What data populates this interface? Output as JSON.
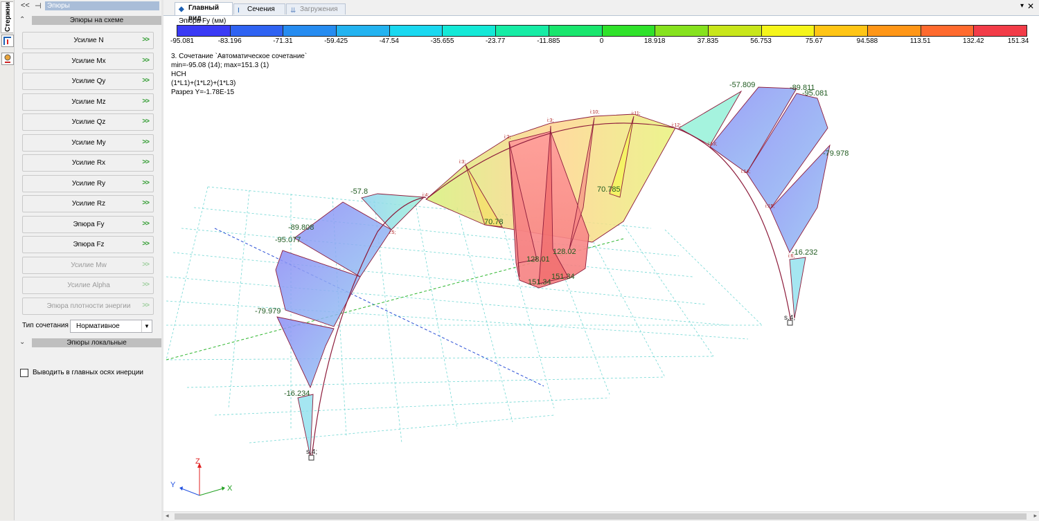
{
  "side_tab": {
    "label": "Стержни"
  },
  "left_panel": {
    "header_back": "<<",
    "header_pin": "⊣",
    "title": "Эпюры",
    "section1": {
      "chevron": "⌃",
      "title": "Эпюры на схеме"
    },
    "buttons": [
      {
        "label": "Усилие N",
        "arrow": ">>",
        "enabled": true
      },
      {
        "label": "Усилие Mx",
        "arrow": ">>",
        "enabled": true
      },
      {
        "label": "Усилие Qy",
        "arrow": ">>",
        "enabled": true
      },
      {
        "label": "Усилие Mz",
        "arrow": ">>",
        "enabled": true
      },
      {
        "label": "Усилие Qz",
        "arrow": ">>",
        "enabled": true
      },
      {
        "label": "Усилие My",
        "arrow": ">>",
        "enabled": true
      },
      {
        "label": "Усилие Rx",
        "arrow": ">>",
        "enabled": true
      },
      {
        "label": "Усилие Ry",
        "arrow": ">>",
        "enabled": true
      },
      {
        "label": "Усилие Rz",
        "arrow": ">>",
        "enabled": true
      },
      {
        "label": "Эпюра Fy",
        "arrow": ">>",
        "enabled": true
      },
      {
        "label": "Эпюра Fz",
        "arrow": ">>",
        "enabled": true
      },
      {
        "label": "Усилие Mw",
        "arrow": ">>",
        "enabled": false
      },
      {
        "label": "Усилие Alpha",
        "arrow": ">>",
        "enabled": false
      },
      {
        "label": "Эпюра плотности энергии",
        "arrow": ">>",
        "enabled": false
      }
    ],
    "combination_type_label": "Тип сочетания",
    "combination_type_value": "Нормативное",
    "section2": {
      "chevron": "⌄",
      "title": "Эпюры локальные"
    },
    "checkbox_label": "Выводить в главных осях инерции",
    "checkbox_checked": false
  },
  "tabs": [
    {
      "label": "Главный вид",
      "icon": "view-icon",
      "active": true,
      "enabled": true
    },
    {
      "label": "Сечения",
      "icon": "section-icon",
      "active": false,
      "enabled": true
    },
    {
      "label": "Загружения",
      "icon": "loads-icon",
      "active": false,
      "enabled": false
    }
  ],
  "tab_menu_glyph": "▾",
  "tab_close_glyph": "✕",
  "legend": {
    "title": "Эпюра Fy (мм)",
    "ticks": [
      "-95.081",
      "-83.196",
      "-71.31",
      "-59.425",
      "-47.54",
      "-35.655",
      "-23.77",
      "-11.885",
      "0",
      "18.918",
      "37.835",
      "56.753",
      "75.67",
      "94.588",
      "113.51",
      "132.42",
      "151.34"
    ],
    "colors": [
      "#3a3af5",
      "#2f63f2",
      "#268cf0",
      "#23b3f0",
      "#1ad8f0",
      "#14e9d7",
      "#16eca5",
      "#19e66d",
      "#2fe22a",
      "#86e21e",
      "#c8e61a",
      "#f5f51a",
      "#ffc515",
      "#ff9617",
      "#ff6a2e",
      "#f23c48"
    ]
  },
  "info": {
    "line1": "3. Сочетание `Автоматическое сочетание`",
    "line2": "min=-95.08 (14); max=151.3 (1)",
    "line3": "НСН",
    "line4": "(1*L1)+(1*L2)+(1*L3)",
    "line5": "Разрез Y=-1.78E-15"
  },
  "labels": {
    "v1": "-57.8",
    "v2": "-89.808",
    "v3": "-95.077",
    "v4": "-79.979",
    "v5": "-16.234",
    "v6": "70.78",
    "v7": "128.01",
    "v8": "128.02",
    "v9": "151.34",
    "v10": "151.34",
    "v11": "70.785",
    "v12": "-57.809",
    "v13": "-89.811",
    "v14": "-95.081",
    "v15": "-79.978",
    "v16": "-16.232",
    "s1": "s.4;",
    "s2": "s.4;"
  },
  "node_labels": [
    "i:3;",
    "i:2;",
    "i:3;",
    "i:10;",
    "i:11;",
    "i:12;",
    "i:4;",
    "i:13;",
    "i:14;",
    "i:15;",
    "i:6;",
    "i:5;"
  ],
  "axes": {
    "z": "Z",
    "y": "Y",
    "x": "X"
  }
}
